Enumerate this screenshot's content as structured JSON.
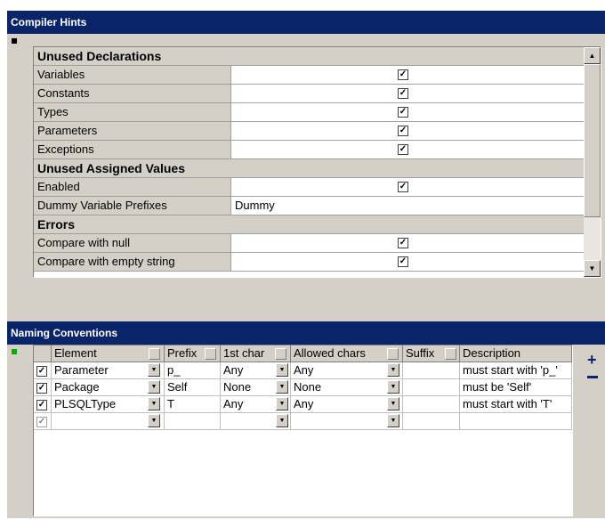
{
  "compiler_hints": {
    "title": "Compiler Hints",
    "rows": [
      {
        "type": "category",
        "label": "Unused Declarations"
      },
      {
        "type": "prop",
        "name": "Variables",
        "checked": true
      },
      {
        "type": "prop",
        "name": "Constants",
        "checked": true
      },
      {
        "type": "prop",
        "name": "Types",
        "checked": true
      },
      {
        "type": "prop",
        "name": "Parameters",
        "checked": true
      },
      {
        "type": "prop",
        "name": "Exceptions",
        "checked": true
      },
      {
        "type": "category",
        "label": "Unused Assigned Values"
      },
      {
        "type": "prop",
        "name": "Enabled",
        "checked": true
      },
      {
        "type": "prop",
        "name": "Dummy Variable Prefixes",
        "text": "Dummy"
      },
      {
        "type": "category",
        "label": "Errors"
      },
      {
        "type": "prop",
        "name": "Compare with null",
        "checked": true
      },
      {
        "type": "prop",
        "name": "Compare with empty string",
        "checked": true
      }
    ],
    "check_glyph": "✓",
    "scroll_up_icon": "▲",
    "scroll_down_icon": "▼"
  },
  "naming_conventions": {
    "title": "Naming Conventions",
    "add_icon": "+",
    "remove_icon": "minus-icon",
    "headers": {
      "element": "Element",
      "prefix": "Prefix",
      "first_char": "1st char",
      "allowed_chars": "Allowed chars",
      "suffix": "Suffix",
      "description": "Description"
    },
    "rows": [
      {
        "checked": true,
        "element": "Parameter",
        "prefix": "p_",
        "first_char": "Any",
        "allowed_chars": "Any",
        "suffix": "",
        "description": "must start with 'p_'"
      },
      {
        "checked": true,
        "element": "Package",
        "prefix": "Self",
        "first_char": "None",
        "allowed_chars": "None",
        "suffix": "",
        "description": "must be 'Self'"
      },
      {
        "checked": true,
        "element": "PLSQLType",
        "prefix": "T",
        "first_char": "Any",
        "allowed_chars": "Any",
        "suffix": "",
        "description": "must start with 'T'"
      },
      {
        "checked": true,
        "element": "",
        "prefix": "",
        "first_char": "",
        "allowed_chars": "",
        "suffix": "",
        "description": ""
      }
    ],
    "dropdown_icon": "▼"
  },
  "colors": {
    "titlebar": "#0a246a",
    "panel_bg": "#d4d0c8",
    "hints_marker": "#000000",
    "naming_marker": "#00b000"
  }
}
